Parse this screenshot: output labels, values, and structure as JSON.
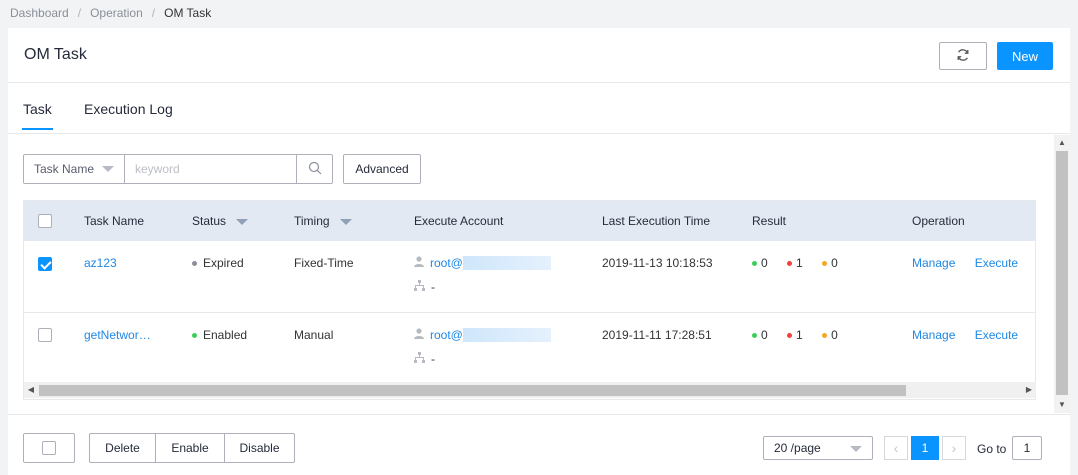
{
  "breadcrumb": {
    "items": [
      "Dashboard",
      "Operation"
    ],
    "current": "OM Task",
    "separator": "/"
  },
  "header": {
    "title": "OM Task",
    "refresh_icon": "refresh-icon",
    "new_label": "New"
  },
  "tabs": [
    {
      "label": "Task",
      "active": true
    },
    {
      "label": "Execution Log",
      "active": false
    }
  ],
  "search": {
    "field_label": "Task Name",
    "placeholder": "keyword",
    "value": "",
    "advanced_label": "Advanced"
  },
  "table": {
    "columns": [
      "Task Name",
      "Status",
      "Timing",
      "Execute Account",
      "Last Execution Time",
      "Result",
      "Operation"
    ],
    "rows": [
      {
        "checked": true,
        "name": "az123",
        "status": "Expired",
        "status_color": "#8a8f99",
        "timing": "Fixed-Time",
        "account": "root@",
        "account_secondary": "-",
        "last_time": "2019-11-13 10:18:53",
        "results": [
          {
            "value": "0",
            "color": "#3dcc5a"
          },
          {
            "value": "1",
            "color": "#f0443c"
          },
          {
            "value": "0",
            "color": "#f5a623"
          }
        ],
        "ops": [
          "Manage",
          "Execute"
        ]
      },
      {
        "checked": false,
        "name": "getNetwor…",
        "status": "Enabled",
        "status_color": "#3dcc5a",
        "timing": "Manual",
        "account": "root@",
        "account_secondary": "-",
        "last_time": "2019-11-11 17:28:51",
        "results": [
          {
            "value": "0",
            "color": "#3dcc5a"
          },
          {
            "value": "1",
            "color": "#f0443c"
          },
          {
            "value": "0",
            "color": "#f5a623"
          }
        ],
        "ops": [
          "Manage",
          "Execute"
        ]
      }
    ]
  },
  "footer": {
    "actions": [
      "Delete",
      "Enable",
      "Disable"
    ],
    "page_size": "20 /page",
    "current_page": "1",
    "goto_label": "Go to",
    "goto_value": "1"
  },
  "colors": {
    "primary": "#0a94ff",
    "link": "#1e88e5",
    "header_bg": "#e3e9f2"
  }
}
